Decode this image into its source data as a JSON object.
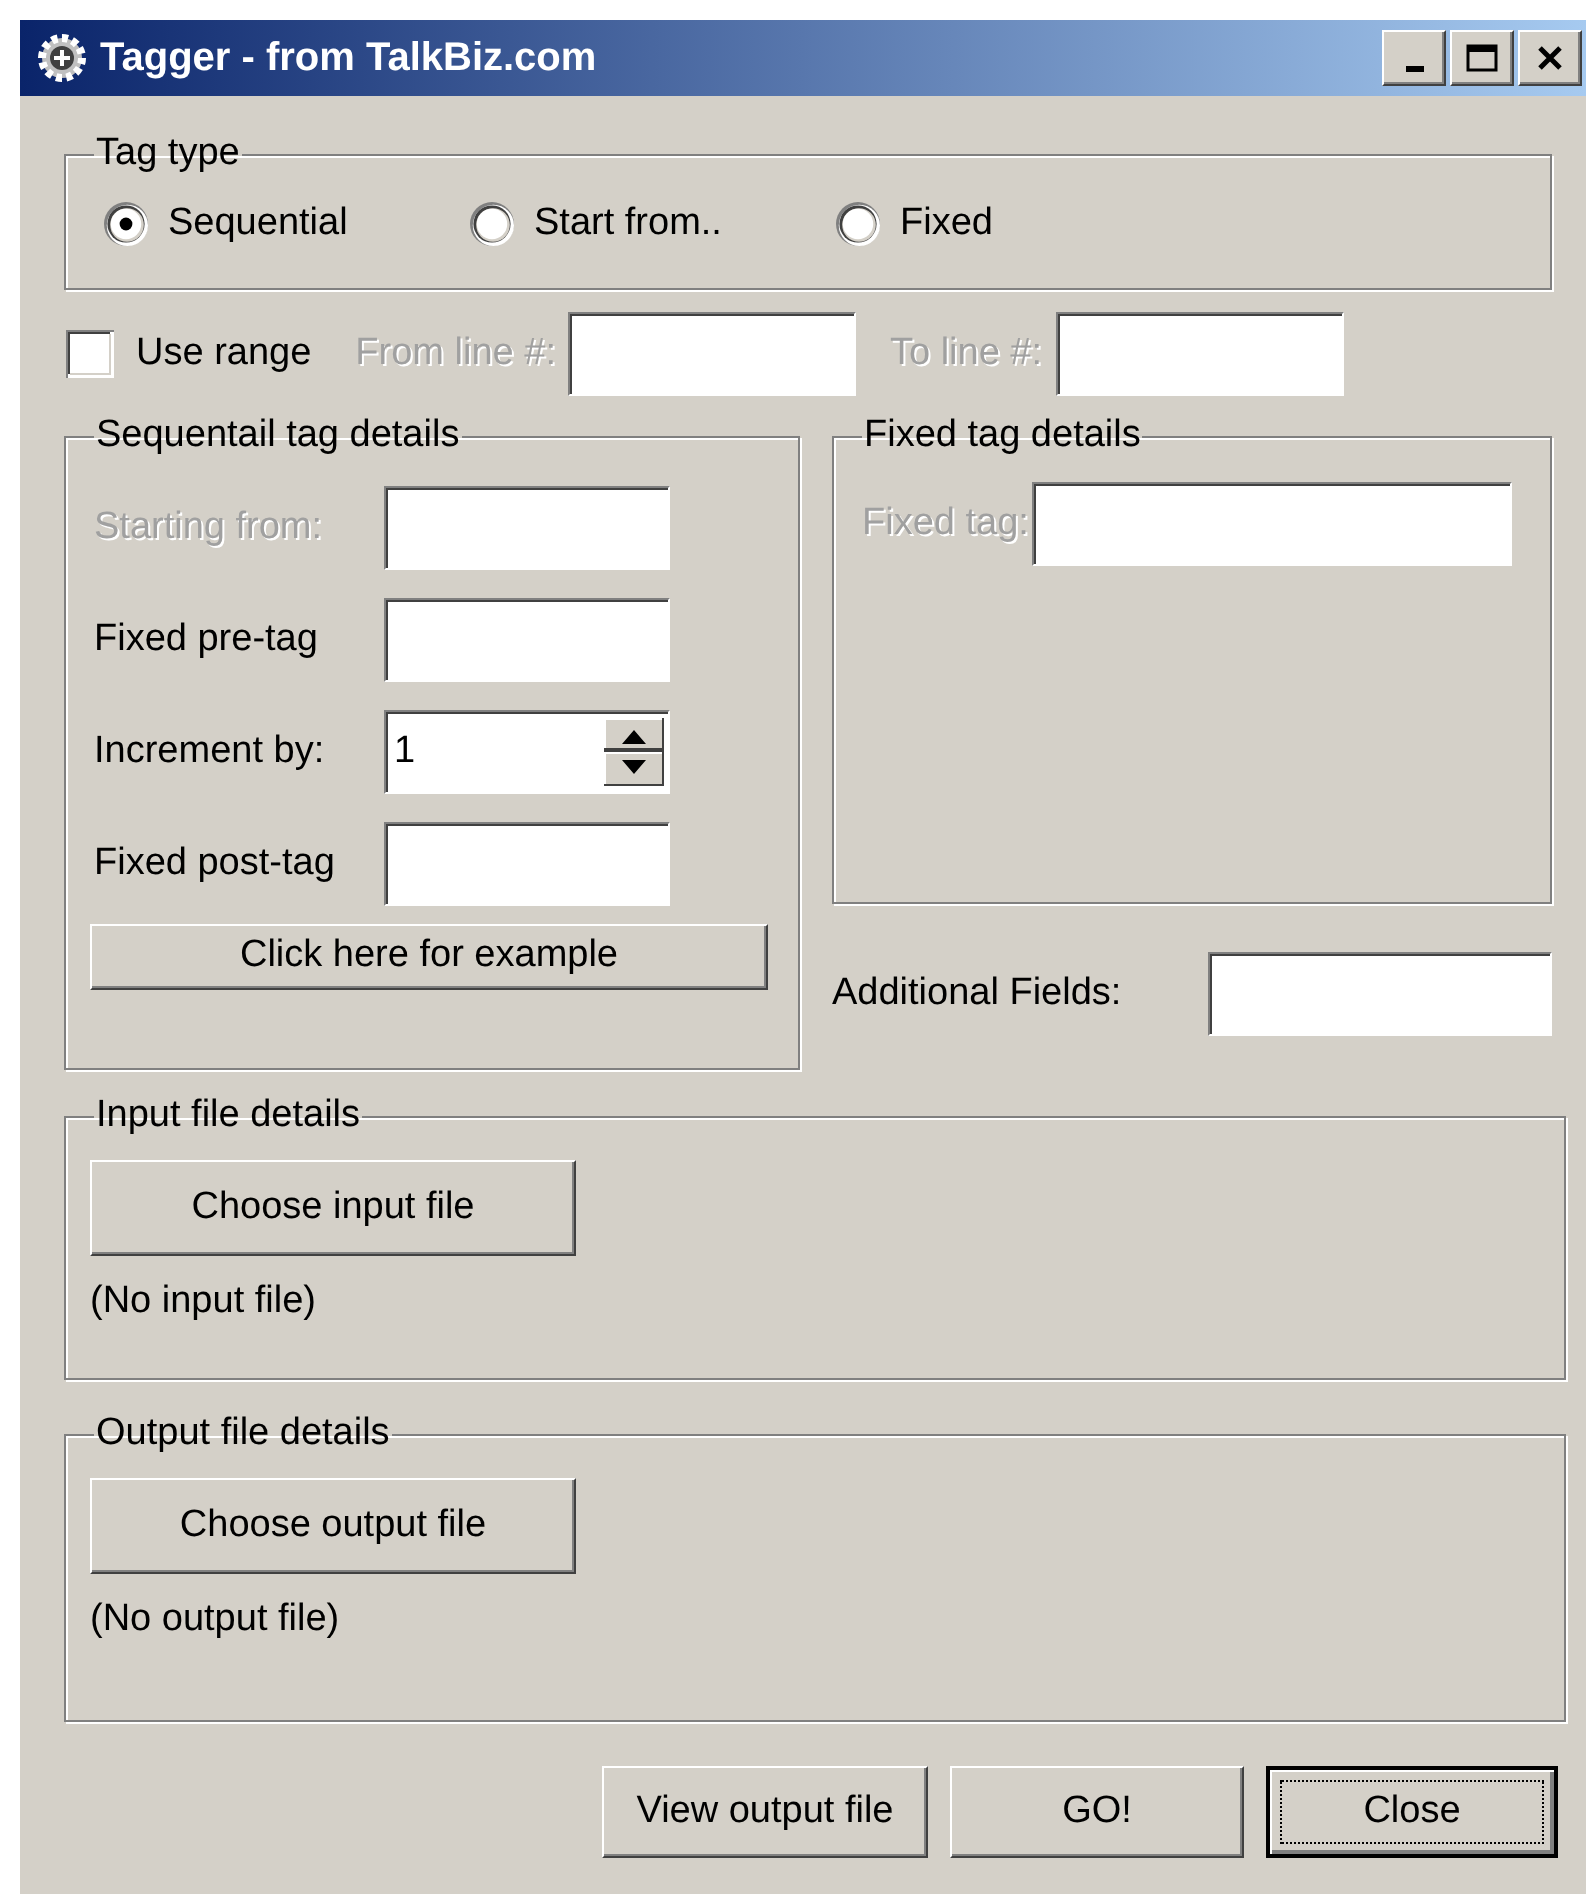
{
  "window": {
    "title": "Tagger - from TalkBiz.com"
  },
  "tag_type": {
    "label": "Tag type",
    "options": [
      {
        "label": "Sequential",
        "selected": true
      },
      {
        "label": "Start from..",
        "selected": false
      },
      {
        "label": "Fixed",
        "selected": false
      }
    ]
  },
  "range": {
    "label": "Use range",
    "checked": false,
    "from_label": "From line #:",
    "to_label": "To line #:",
    "disabled": true
  },
  "sequential_details": {
    "label": "Sequentail tag details",
    "fields": [
      {
        "kind": "text",
        "label": "Starting from:",
        "disabled": true
      },
      {
        "kind": "text",
        "label": "Fixed pre-tag",
        "disabled": false
      },
      {
        "kind": "spin",
        "label": "Increment by:",
        "disabled": false,
        "value": "1"
      },
      {
        "kind": "text",
        "label": "Fixed post-tag",
        "disabled": false
      }
    ],
    "button": "Click here for example"
  },
  "fixed_details": {
    "label": "Fixed tag details",
    "field": {
      "label": "Fixed tag:",
      "disabled": true
    }
  },
  "additional_fields": {
    "label": "Additional Fields:"
  },
  "input_file": {
    "label": "Input file details",
    "button": "Choose input file",
    "status": "(No input file)"
  },
  "output_file": {
    "label": "Output file details",
    "button": "Choose output file",
    "status": "(No output file)"
  },
  "buttons": [
    {
      "label": "View output file",
      "default": false
    },
    {
      "label": "GO!",
      "default": false
    },
    {
      "label": "Close",
      "default": true
    }
  ]
}
